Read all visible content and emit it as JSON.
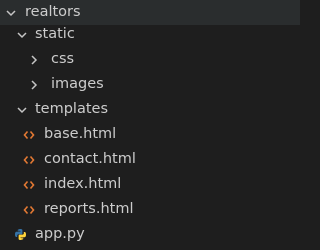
{
  "explorer": {
    "items": [
      {
        "label": "realtors",
        "type": "folder",
        "expanded": true,
        "depth": 0,
        "icon": "chevron-down-icon"
      },
      {
        "label": "static",
        "type": "folder",
        "expanded": true,
        "depth": 1,
        "icon": "chevron-down-icon"
      },
      {
        "label": "css",
        "type": "folder",
        "expanded": false,
        "depth": 2,
        "icon": "chevron-right-icon"
      },
      {
        "label": "images",
        "type": "folder",
        "expanded": false,
        "depth": 2,
        "icon": "chevron-right-icon"
      },
      {
        "label": "templates",
        "type": "folder",
        "expanded": true,
        "depth": 1,
        "icon": "chevron-down-icon"
      },
      {
        "label": "base.html",
        "type": "file",
        "depth": 2,
        "icon": "html-file-icon"
      },
      {
        "label": "contact.html",
        "type": "file",
        "depth": 2,
        "icon": "html-file-icon"
      },
      {
        "label": "index.html",
        "type": "file",
        "depth": 2,
        "icon": "html-file-icon"
      },
      {
        "label": "reports.html",
        "type": "file",
        "depth": 2,
        "icon": "html-file-icon"
      },
      {
        "label": "app.py",
        "type": "file",
        "depth": 1,
        "icon": "python-file-icon"
      }
    ]
  },
  "colors": {
    "background": "#1e1e1e",
    "text": "#cccccc",
    "chevron": "#c5c5c5",
    "html_icon": "#e37933",
    "python_blue": "#3572a5",
    "python_yellow": "#ffd43b"
  }
}
